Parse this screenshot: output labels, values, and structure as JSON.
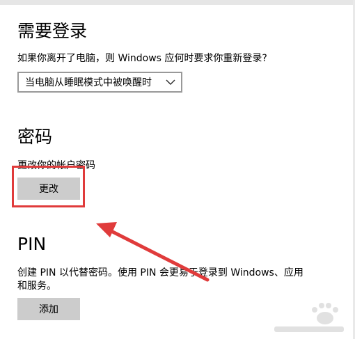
{
  "signin": {
    "title": "需要登录",
    "description": "如果你离开了电脑，则 Windows 应何时要求你重新登录?",
    "dropdown_value": "当电脑从睡眠模式中被唤醒时"
  },
  "password": {
    "title": "密码",
    "description": "更改你的帐户密码",
    "button_label": "更改"
  },
  "pin": {
    "title": "PIN",
    "description_line1": "创建 PIN 以代替密码。使用 PIN 会更易于登录到 Windows、应用",
    "description_line2": "和服务。",
    "button_label": "添加"
  },
  "annotation": {
    "color": "#e03b3b"
  },
  "colors": {
    "button_bg": "#cccccc",
    "dropdown_border": "#999999"
  }
}
